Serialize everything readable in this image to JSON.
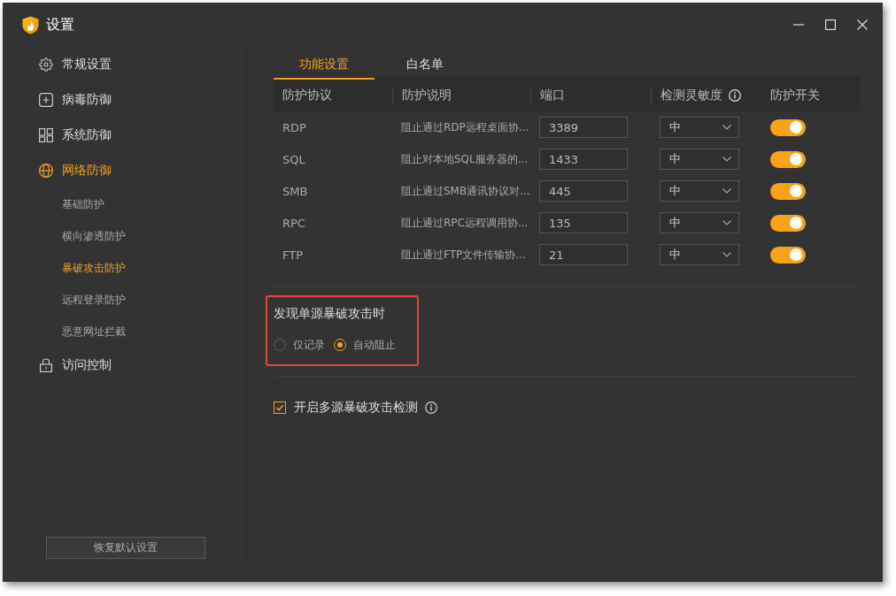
{
  "window": {
    "title": "设置"
  },
  "sidebar": {
    "items": [
      {
        "label": "常规设置",
        "selected": false
      },
      {
        "label": "病毒防御",
        "selected": false
      },
      {
        "label": "系统防御",
        "selected": false
      },
      {
        "label": "网络防御",
        "selected": true,
        "children": [
          {
            "label": "基础防护",
            "selected": false
          },
          {
            "label": "横向渗透防护",
            "selected": false
          },
          {
            "label": "暴破攻击防护",
            "selected": true
          },
          {
            "label": "远程登录防护",
            "selected": false
          },
          {
            "label": "恶意网址拦截",
            "selected": false
          }
        ]
      },
      {
        "label": "访问控制",
        "selected": false
      }
    ],
    "reset_button": "恢复默认设置"
  },
  "tabs": [
    {
      "label": "功能设置",
      "selected": true
    },
    {
      "label": "白名单",
      "selected": false
    }
  ],
  "table": {
    "columns": [
      {
        "label": "防护协议",
        "info": false
      },
      {
        "label": "防护说明",
        "info": false
      },
      {
        "label": "端口",
        "info": false
      },
      {
        "label": "检测灵敏度",
        "info": true
      },
      {
        "label": "防护开关",
        "info": false
      }
    ],
    "rows": [
      {
        "protocol": "RDP",
        "description": "阻止通过RDP远程桌面协...",
        "port": "3389",
        "sensitivity": "中",
        "on": true
      },
      {
        "protocol": "SQL",
        "description": "阻止对本地SQL服务器的...",
        "port": "1433",
        "sensitivity": "中",
        "on": true
      },
      {
        "protocol": "SMB",
        "description": "阻止通过SMB通讯协议对...",
        "port": "445",
        "sensitivity": "中",
        "on": true
      },
      {
        "protocol": "RPC",
        "description": "阻止通过RPC远程调用协...",
        "port": "135",
        "sensitivity": "中",
        "on": true
      },
      {
        "protocol": "FTP",
        "description": "阻止通过FTP文件传输协...",
        "port": "21",
        "sensitivity": "中",
        "on": true
      }
    ]
  },
  "single_source": {
    "highlighted": true,
    "title": "发现单源暴破攻击时",
    "options": [
      {
        "label": "仅记录",
        "selected": false
      },
      {
        "label": "自动阻止",
        "selected": true
      }
    ]
  },
  "multi_source": {
    "label": "开启多源暴破攻击检测",
    "checked": true,
    "info": true
  }
}
